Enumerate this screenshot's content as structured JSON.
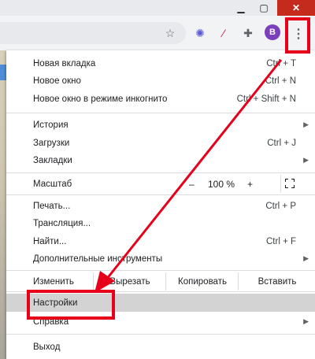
{
  "window": {
    "minimize": "▁",
    "maximize": "▢",
    "close": "✕"
  },
  "toolbar": {
    "avatar_letter": "B",
    "kebab": "⋮"
  },
  "menu": {
    "new_tab": {
      "label": "Новая вкладка",
      "shortcut": "Ctrl + T"
    },
    "new_window": {
      "label": "Новое окно",
      "shortcut": "Ctrl + N"
    },
    "incognito": {
      "label": "Новое окно в режиме инкогнито",
      "shortcut": "Ctrl + Shift + N"
    },
    "history": {
      "label": "История"
    },
    "downloads": {
      "label": "Загрузки",
      "shortcut": "Ctrl + J"
    },
    "bookmarks": {
      "label": "Закладки"
    },
    "zoom": {
      "label": "Масштаб",
      "minus": "–",
      "value": "100 %",
      "plus": "+"
    },
    "print": {
      "label": "Печать...",
      "shortcut": "Ctrl + P"
    },
    "cast": {
      "label": "Трансляция..."
    },
    "find": {
      "label": "Найти...",
      "shortcut": "Ctrl + F"
    },
    "more_tools": {
      "label": "Дополнительные инструменты"
    },
    "edit": {
      "label": "Изменить",
      "cut": "Вырезать",
      "copy": "Копировать",
      "paste": "Вставить"
    },
    "settings": {
      "label": "Настройки"
    },
    "help": {
      "label": "Справка"
    },
    "exit": {
      "label": "Выход"
    }
  },
  "annotation": {
    "color": "#e6001a"
  }
}
